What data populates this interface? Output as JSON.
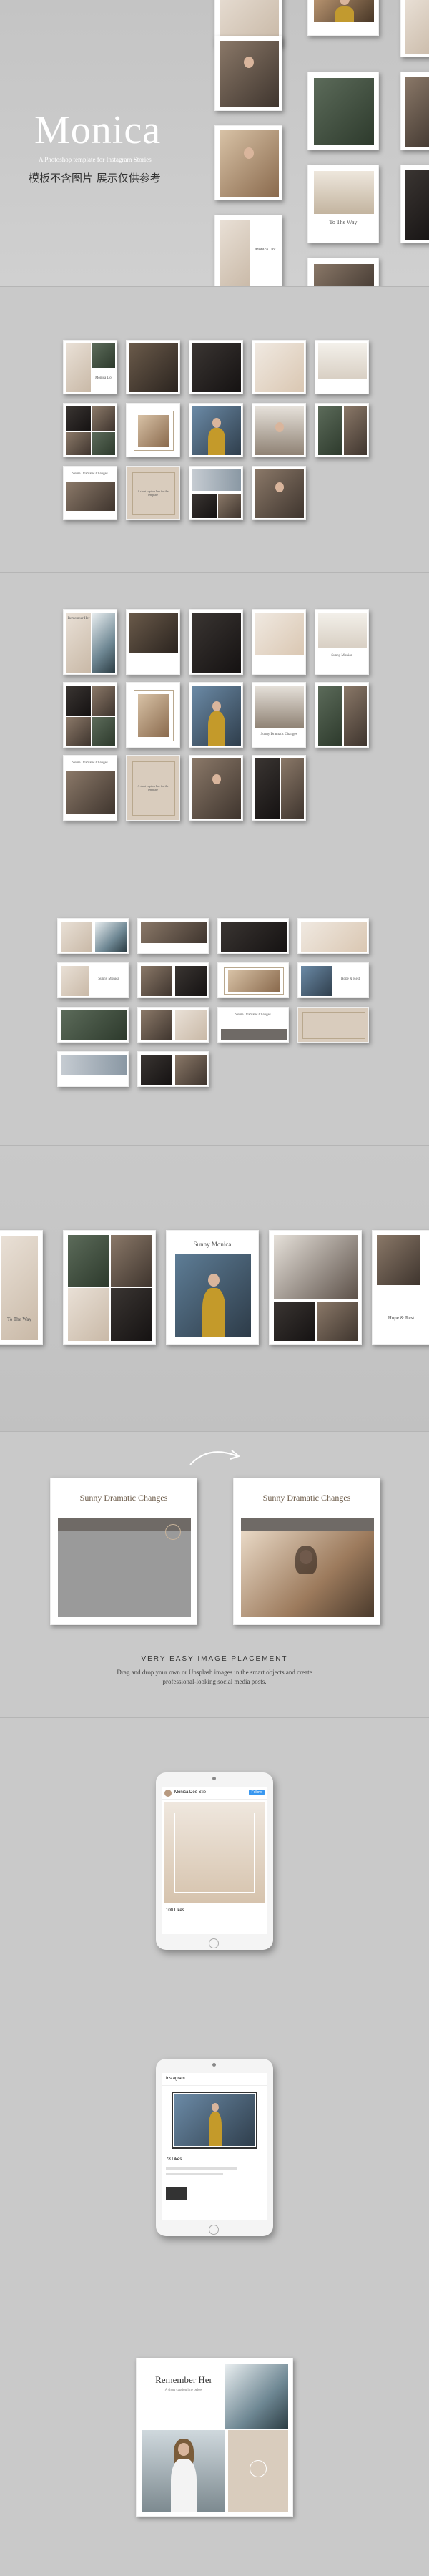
{
  "hero": {
    "title": "Monica",
    "subtitle": "A Photoshop template for Instagram Stories",
    "cn_note": "模板不含图片 展示仅供参考"
  },
  "card_texts": {
    "monica_dot": "Monica Dot",
    "sunny_monica": "Sunny Monica",
    "the_way": "To The Way",
    "remember_her": "Remember Her",
    "some_dramatic": "Some Dramatic Changes",
    "sunny_dramatic": "Sunny Dramatic Changes",
    "about": "A short caption line for the template",
    "hope": "Hope & Rest",
    "monica_style": "Monica Style"
  },
  "placement": {
    "heading": "VERY EASY IMAGE PLACEMENT",
    "body": "Drag and drop your own or Unsplash images in the smart objects and create professional-looking social media posts.",
    "before_title": "Sunny Dramatic Changes",
    "after_title": "Sunny Dramatic Changes"
  },
  "tablet1": {
    "account": "Monica Dee Stie",
    "follow": "Follow",
    "likes": "100 Likes"
  },
  "tablet2": {
    "account": "Instagram",
    "likes": "78 Likes"
  },
  "final": {
    "title": "Remember Her",
    "caption": "A short caption line below"
  },
  "colors": {
    "background": "#c9c9c9",
    "beige": "#d9ccbd",
    "accent_gray": "#6f6a66",
    "ig_blue": "#3897f0"
  }
}
